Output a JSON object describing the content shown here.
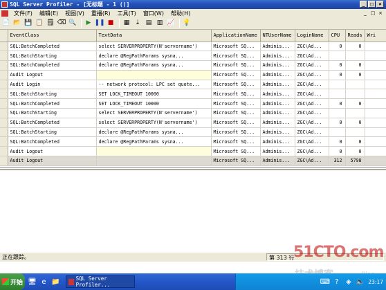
{
  "window": {
    "title": "SQL Server Profiler - [无标题 - 1 ()]",
    "controls": [
      "_",
      "□",
      "×"
    ]
  },
  "menu": {
    "items": [
      "文件(F)",
      "编辑(E)",
      "视图(V)",
      "重播(R)",
      "工具(T)",
      "窗口(W)",
      "帮助(H)"
    ],
    "mdi_controls": [
      "_",
      "□",
      "×"
    ]
  },
  "toolbar": {
    "icons": [
      "new-trace-icon",
      "open-icon",
      "save-icon",
      "template-icon",
      "properties-icon",
      "erase-icon",
      "find-icon",
      "run-icon",
      "pause-icon",
      "stop-icon",
      "events-icon",
      "autoscroll-icon",
      "clear-icon",
      "filter-icon",
      "perf-icon",
      "help-icon"
    ]
  },
  "grid": {
    "columns": [
      "EventClass",
      "TextData",
      "ApplicationName",
      "NTUserName",
      "LoginName",
      "CPU",
      "Reads",
      "Wri"
    ],
    "rows": [
      {
        "event": "SQL:BatchCompleted",
        "text": "select SERVERPROPERTY(N'servername')",
        "app": "Microsoft SQ...",
        "nt": "Adminis...",
        "login": "ZGC\\Ad...",
        "cpu": "0",
        "reads": "0",
        "writes": "",
        "yellow": false
      },
      {
        "event": "SQL:BatchStarting",
        "text": "      declare @RegPathParams sysna...",
        "app": "Microsoft SQ...",
        "nt": "Adminis...",
        "login": "ZGC\\Ad...",
        "cpu": "",
        "reads": "",
        "writes": "",
        "yellow": false
      },
      {
        "event": "SQL:BatchCompleted",
        "text": "      declare @RegPathParams sysna...",
        "app": "Microsoft SQ...",
        "nt": "Adminis...",
        "login": "ZGC\\Ad...",
        "cpu": "0",
        "reads": "0",
        "writes": "",
        "yellow": false
      },
      {
        "event": "Audit Logout",
        "text": "",
        "app": "Microsoft SQ...",
        "nt": "Adminis...",
        "login": "ZGC\\Ad...",
        "cpu": "0",
        "reads": "0",
        "writes": "",
        "yellow": true
      },
      {
        "event": "Audit Login",
        "text": "-- network protocol: LPC  set quote...",
        "app": "Microsoft SQ...",
        "nt": "Adminis...",
        "login": "ZGC\\Ad...",
        "cpu": "",
        "reads": "",
        "writes": "",
        "yellow": false
      },
      {
        "event": "SQL:BatchStarting",
        "text": "SET LOCK_TIMEOUT 10000",
        "app": "Microsoft SQ...",
        "nt": "Adminis...",
        "login": "ZGC\\Ad...",
        "cpu": "",
        "reads": "",
        "writes": "",
        "yellow": false
      },
      {
        "event": "SQL:BatchCompleted",
        "text": "SET LOCK_TIMEOUT 10000",
        "app": "Microsoft SQ...",
        "nt": "Adminis...",
        "login": "ZGC\\Ad...",
        "cpu": "0",
        "reads": "0",
        "writes": "",
        "yellow": false
      },
      {
        "event": "SQL:BatchStarting",
        "text": "select SERVERPROPERTY(N'servername')",
        "app": "Microsoft SQ...",
        "nt": "Adminis...",
        "login": "ZGC\\Ad...",
        "cpu": "",
        "reads": "",
        "writes": "",
        "yellow": false
      },
      {
        "event": "SQL:BatchCompleted",
        "text": "select SERVERPROPERTY(N'servername')",
        "app": "Microsoft SQ...",
        "nt": "Adminis...",
        "login": "ZGC\\Ad...",
        "cpu": "0",
        "reads": "0",
        "writes": "",
        "yellow": false
      },
      {
        "event": "SQL:BatchStarting",
        "text": "      declare @RegPathParams sysna...",
        "app": "Microsoft SQ...",
        "nt": "Adminis...",
        "login": "ZGC\\Ad...",
        "cpu": "",
        "reads": "",
        "writes": "",
        "yellow": false
      },
      {
        "event": "SQL:BatchCompleted",
        "text": "      declare @RegPathParams sysna...",
        "app": "Microsoft SQ...",
        "nt": "Adminis...",
        "login": "ZGC\\Ad...",
        "cpu": "0",
        "reads": "0",
        "writes": "",
        "yellow": false
      },
      {
        "event": "Audit Logout",
        "text": "",
        "app": "Microsoft SQ...",
        "nt": "Adminis...",
        "login": "ZGC\\Ad...",
        "cpu": "0",
        "reads": "0",
        "writes": "",
        "yellow": true
      },
      {
        "event": "Audit Logout",
        "text": "",
        "app": "Microsoft SQ...",
        "nt": "Adminis...",
        "login": "ZGC\\Ad...",
        "cpu": "312",
        "reads": "5798",
        "writes": "",
        "yellow": false,
        "selected": true
      }
    ]
  },
  "status": {
    "text": "正在跟踪。",
    "row_indicator": "第 313 行"
  },
  "taskbar": {
    "start_label": "开始",
    "task_item": "SQL Server Profiler...",
    "clock": "23:17"
  },
  "watermark": {
    "logo": "51CTO.com",
    "subtitle": "技术博客",
    "blog": "Blog"
  },
  "colors": {
    "title_blue": "#2352b8",
    "chrome": "#ece9d8",
    "yellow_row": "#fefedc",
    "taskbar_blue": "#2456c8"
  }
}
